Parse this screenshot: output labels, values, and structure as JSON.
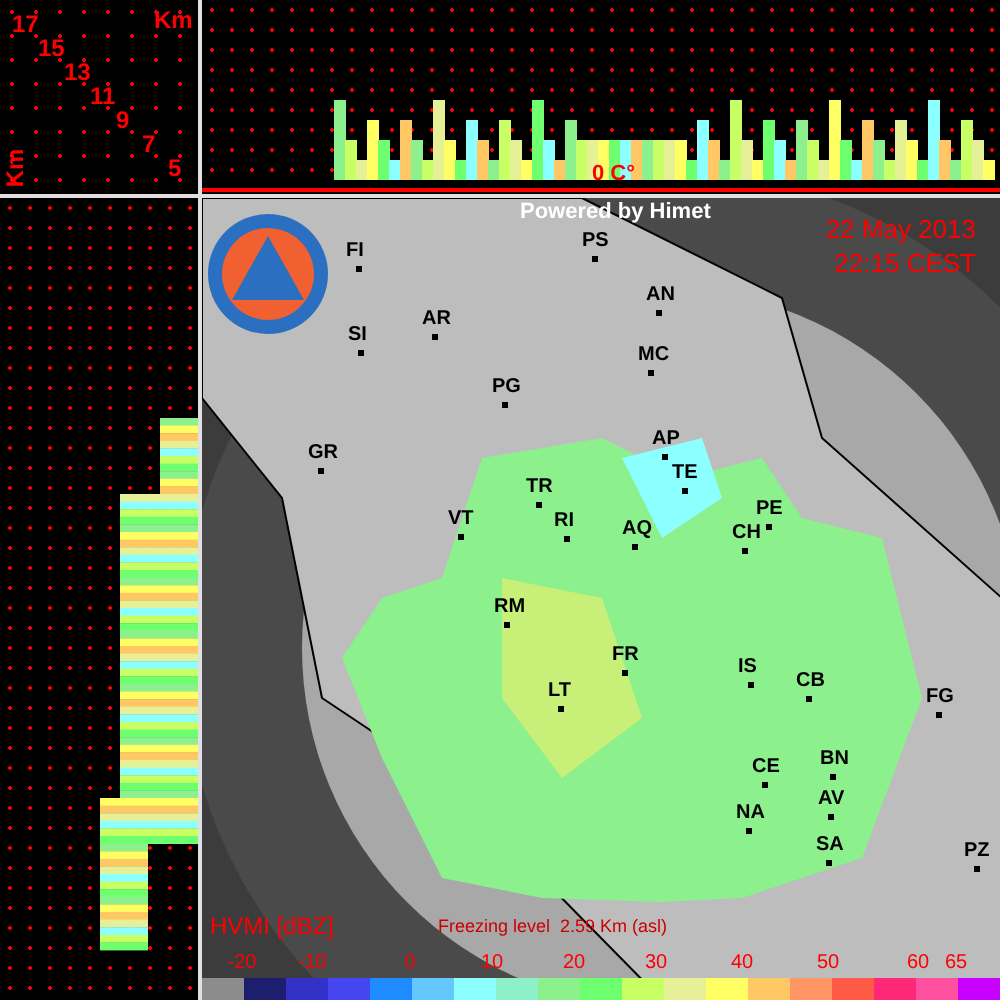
{
  "height_scale": {
    "unit_top": "Km",
    "unit_side": "Km",
    "labels": [
      "17",
      "15",
      "13",
      "11",
      "9",
      "7",
      "5"
    ]
  },
  "top_profile": {
    "freezing_mark": "0 C°"
  },
  "map": {
    "credit": "Powered by Himet",
    "date": "22 May 2013",
    "time": "22:15 CEST",
    "cities": [
      "FI",
      "SI",
      "AR",
      "PG",
      "PS",
      "AN",
      "MC",
      "GR",
      "AP",
      "TE",
      "TR",
      "VT",
      "RI",
      "AQ",
      "PE",
      "CH",
      "RM",
      "FR",
      "IS",
      "CB",
      "FG",
      "LT",
      "CE",
      "BN",
      "AV",
      "NA",
      "SA",
      "PZ"
    ],
    "product": "HVMI [dBZ]",
    "freezing_level": "Freezing level  2.59 Km (asl)"
  },
  "legend": {
    "ticks": [
      "-20",
      "-10",
      "0",
      "10",
      "20",
      "30",
      "40",
      "50",
      "60",
      "65"
    ],
    "swatches": [
      {
        "color": "#8c8c8c"
      },
      {
        "color": "#1e1e6e"
      },
      {
        "color": "#3232c8"
      },
      {
        "color": "#4646f0"
      },
      {
        "color": "#1e8cff"
      },
      {
        "color": "#64c8ff"
      },
      {
        "color": "#8cffff"
      },
      {
        "color": "#8cf0c8"
      },
      {
        "color": "#8cf08c"
      },
      {
        "color": "#6eff6e"
      },
      {
        "color": "#c8ff64"
      },
      {
        "color": "#e6f096"
      },
      {
        "color": "#ffff64"
      },
      {
        "color": "#ffc864"
      },
      {
        "color": "#ff9664"
      },
      {
        "color": "#ff5a46"
      },
      {
        "color": "#ff2878"
      },
      {
        "color": "#ff50a0"
      },
      {
        "color": "#c800ff"
      }
    ]
  }
}
